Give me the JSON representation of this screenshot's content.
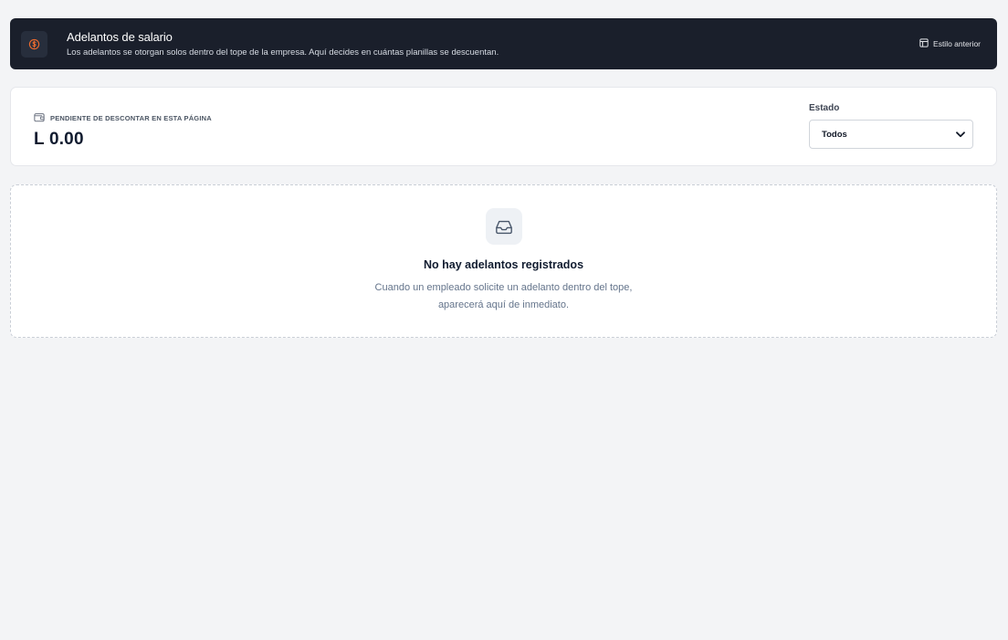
{
  "header": {
    "title": "Adelantos de salario",
    "subtitle": "Los adelantos se otorgan solos dentro del tope de la empresa. Aquí decides en cuántas planillas se descuentan.",
    "icon": "coin-icon",
    "action_label": "Estilo anterior",
    "action_icon": "layout-icon",
    "accent_color": "#ea6a2e"
  },
  "summary": {
    "pending_label": "PENDIENTE DE DESCONTAR EN ESTA PÁGINA",
    "pending_icon": "wallet-icon",
    "pending_amount": "L 0.00",
    "filter": {
      "label": "Estado",
      "selected": "Todos"
    }
  },
  "empty_state": {
    "icon": "inbox-icon",
    "title": "No hay adelantos registrados",
    "description_line1": "Cuando un empleado solicite un adelanto dentro del tope,",
    "description_line2": "aparecerá aquí de inmediato."
  }
}
